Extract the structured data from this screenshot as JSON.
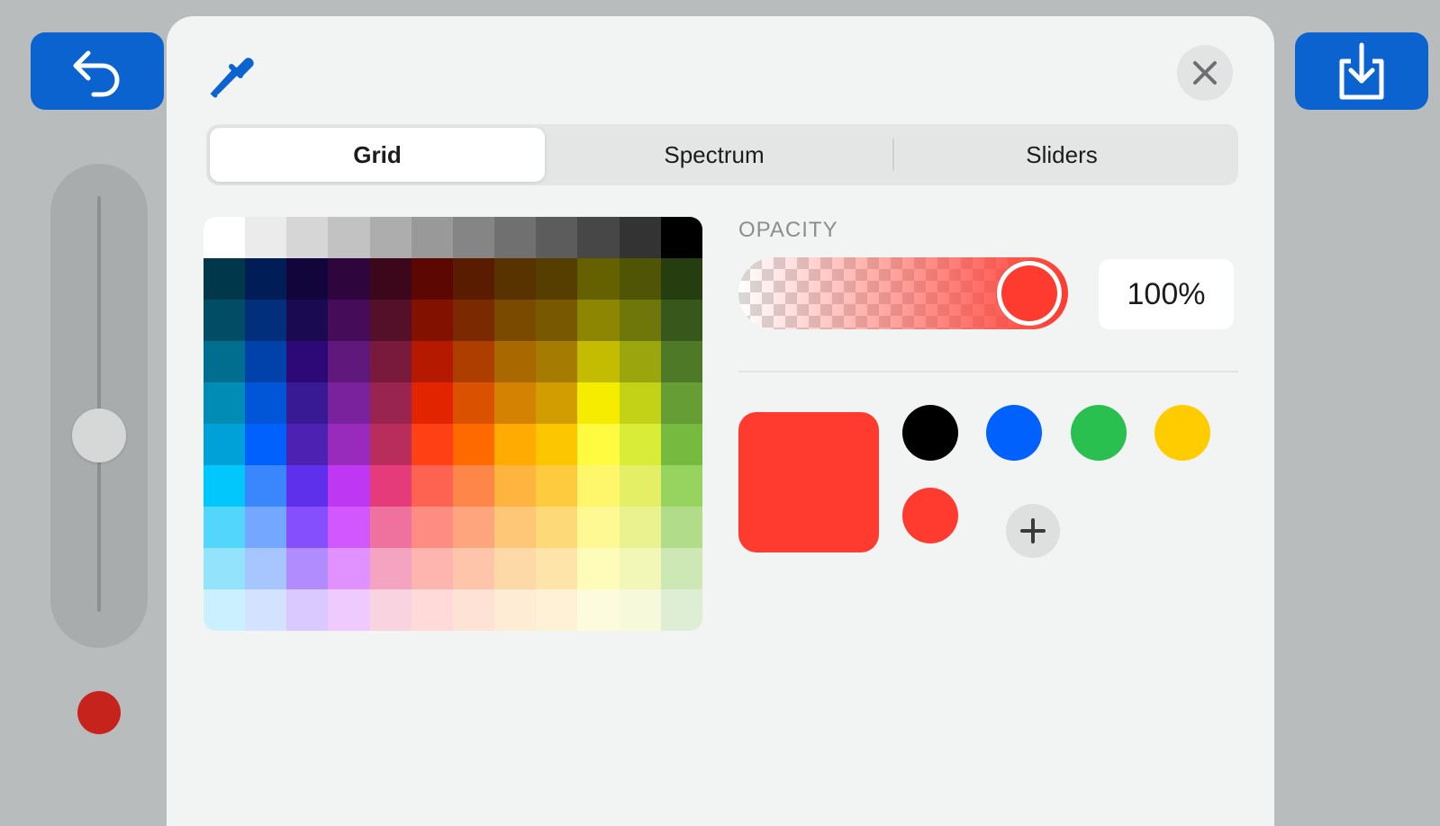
{
  "toolbar": {
    "undo_icon": "undo-arrow-icon",
    "export_icon": "export-download-icon",
    "accent_color": "#0a63cf"
  },
  "side": {
    "current_color": "#c7231d"
  },
  "picker": {
    "eyedropper_icon": "eyedropper-icon",
    "close_icon": "close-icon",
    "tabs": [
      {
        "label": "Grid",
        "active": true
      },
      {
        "label": "Spectrum",
        "active": false
      },
      {
        "label": "Sliders",
        "active": false
      }
    ],
    "grid_colors": [
      [
        "#ffffff",
        "#ebebeb",
        "#d6d6d6",
        "#c2c2c2",
        "#adadad",
        "#999999",
        "#858585",
        "#707070",
        "#5c5c5c",
        "#474747",
        "#333333",
        "#000000"
      ],
      [
        "#00374a",
        "#011d57",
        "#11053b",
        "#2e063d",
        "#3c071b",
        "#5c0701",
        "#5a1c00",
        "#583300",
        "#563d00",
        "#666100",
        "#4f5504",
        "#263e0f"
      ],
      [
        "#004d65",
        "#012f7b",
        "#1a0a52",
        "#450d59",
        "#551029",
        "#831100",
        "#7b2900",
        "#7a4a00",
        "#785800",
        "#8c8602",
        "#6f760a",
        "#38571a"
      ],
      [
        "#016e8f",
        "#0042a9",
        "#2c0977",
        "#61187c",
        "#791a3d",
        "#b51a00",
        "#ad3e00",
        "#a96800",
        "#a67b01",
        "#c4bc00",
        "#9ba50e",
        "#4e7a27"
      ],
      [
        "#008cb4",
        "#0056d6",
        "#371a94",
        "#7a219e",
        "#99244f",
        "#e22400",
        "#da5100",
        "#d38301",
        "#d19d01",
        "#f5ec00",
        "#c3d117",
        "#669d34"
      ],
      [
        "#00a1d8",
        "#0061fd",
        "#4d22b2",
        "#982abc",
        "#b92d5d",
        "#ff4015",
        "#ff6a00",
        "#ffab01",
        "#fdc700",
        "#fefb41",
        "#d9ec37",
        "#76bb40"
      ],
      [
        "#01c7fc",
        "#3a87fd",
        "#5e30eb",
        "#be38f3",
        "#e63b7a",
        "#fe6250",
        "#fe8648",
        "#feb43f",
        "#fecb3e",
        "#fff76b",
        "#e4ef65",
        "#96d35f"
      ],
      [
        "#52d6fc",
        "#74a7ff",
        "#864ffd",
        "#d357fe",
        "#ee719e",
        "#ff8c82",
        "#fea57d",
        "#fec777",
        "#fed977",
        "#fff994",
        "#eaf28f",
        "#b1dd8b"
      ],
      [
        "#93e3fc",
        "#a7c6ff",
        "#b18cfe",
        "#e292fe",
        "#f4a4c0",
        "#ffb5af",
        "#ffc5ab",
        "#fed9a8",
        "#fee4a8",
        "#fffbb9",
        "#f2f7b7",
        "#cde8b5"
      ],
      [
        "#cbf0ff",
        "#d3e2ff",
        "#d9c9fe",
        "#efcaff",
        "#f9d3e0",
        "#ffdad8",
        "#ffe2d6",
        "#feecd4",
        "#fef1d5",
        "#fdfbdd",
        "#f6fadb",
        "#deeed4"
      ]
    ],
    "opacity": {
      "label": "OPACITY",
      "value": 1.0,
      "value_text": "100%",
      "color": "#ff3b30"
    },
    "current_swatch_color": "#ff3b30",
    "saved_colors": [
      "#000000",
      "#0061fd",
      "#29c04f",
      "#ffcc00",
      "#ff3b30"
    ],
    "add_icon": "plus-icon"
  }
}
